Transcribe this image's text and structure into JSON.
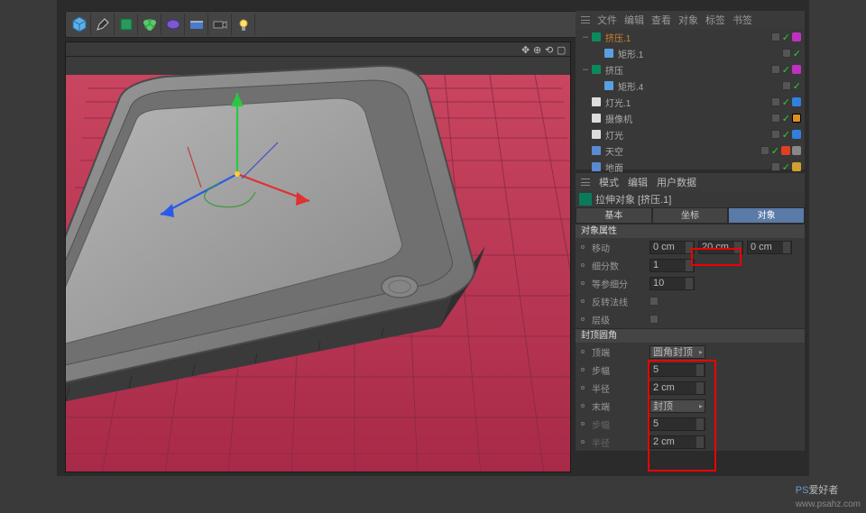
{
  "om_menu": {
    "file": "文件",
    "edit": "编辑",
    "view": "查看",
    "object": "对象",
    "tags": "标签",
    "bookmarks": "书签"
  },
  "hierarchy": {
    "items": [
      {
        "label": "挤压.1",
        "color": "#0a8a5a",
        "text": "#d08030",
        "indent": 0,
        "exp": "–"
      },
      {
        "label": "矩形.1",
        "color": "#5aa0e0",
        "text": "#aaa",
        "indent": 1,
        "exp": ""
      },
      {
        "label": "挤压",
        "color": "#0a8a5a",
        "text": "#aaa",
        "indent": 0,
        "exp": "–"
      },
      {
        "label": "矩形.4",
        "color": "#5aa0e0",
        "text": "#aaa",
        "indent": 1,
        "exp": ""
      },
      {
        "label": "灯光.1",
        "color": "#ddd",
        "text": "#aaa",
        "indent": 0,
        "exp": ""
      },
      {
        "label": "摄像机",
        "color": "#ddd",
        "text": "#aaa",
        "indent": 0,
        "exp": ""
      },
      {
        "label": "灯光",
        "color": "#ddd",
        "text": "#aaa",
        "indent": 0,
        "exp": ""
      },
      {
        "label": "天空",
        "color": "#5a8ad0",
        "text": "#aaa",
        "indent": 0,
        "exp": ""
      },
      {
        "label": "地面",
        "color": "#5a8ad0",
        "text": "#aaa",
        "indent": 0,
        "exp": ""
      }
    ]
  },
  "attr_menu": {
    "mode": "模式",
    "edit": "编辑",
    "userdata": "用户数据"
  },
  "attr_title": "拉伸对象 [挤压.1]",
  "tabs": {
    "basic": "基本",
    "coord": "坐标",
    "object": "对象"
  },
  "sections": {
    "props": "对象属性",
    "caps": "封顶圆角"
  },
  "props": {
    "move": {
      "label": "移动",
      "x": "0 cm",
      "y": "20 cm",
      "z": "0 cm"
    },
    "subdiv": {
      "label": "细分数",
      "val": "1"
    },
    "iso": {
      "label": "等参细分",
      "val": "10"
    },
    "flip": {
      "label": "反转法线"
    },
    "hier": {
      "label": "层级"
    }
  },
  "caps": {
    "start": {
      "label": "顶端",
      "val": "圆角封顶"
    },
    "steps1": {
      "label": "步幅",
      "val": "5"
    },
    "rad1": {
      "label": "半径",
      "val": "2 cm"
    },
    "end": {
      "label": "末端",
      "val": "封顶"
    },
    "steps2": {
      "label": "步幅",
      "val": "5"
    },
    "rad2": {
      "label": "半径",
      "val": "2 cm"
    }
  },
  "watermark": {
    "pre": "PS",
    "mid": "爱好者",
    "url": "www.psahz.com"
  }
}
